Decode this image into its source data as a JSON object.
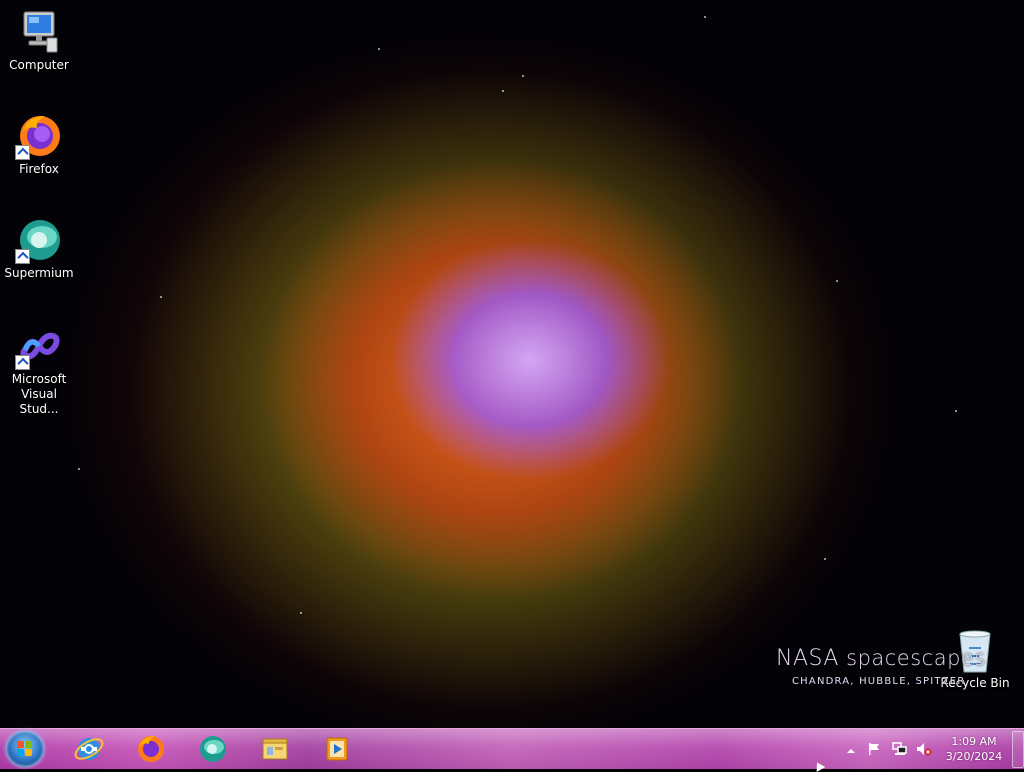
{
  "desktop": {
    "wallpaper": "Crab Nebula",
    "watermark": {
      "title_a": "NASA",
      "title_b": "spacescapes",
      "subtitle": "CHANDRA, HUBBLE, SPITZER"
    },
    "icons": [
      {
        "label": "Computer",
        "icon": "computer-icon"
      },
      {
        "label": "Firefox",
        "icon": "firefox-icon"
      },
      {
        "label": "Supermium",
        "icon": "supermium-icon"
      },
      {
        "label_line1": "Microsoft",
        "label_line2": "Visual Stud...",
        "icon": "visual-studio-icon"
      },
      {
        "label": "Recycle Bin",
        "icon": "recycle-bin-icon"
      }
    ]
  },
  "taskbar": {
    "start": {
      "icon": "windows-start-icon"
    },
    "pinned": [
      {
        "icon": "internet-explorer-icon"
      },
      {
        "icon": "firefox-icon"
      },
      {
        "icon": "supermium-icon"
      },
      {
        "icon": "file-explorer-icon"
      },
      {
        "icon": "media-player-icon"
      }
    ],
    "tray": {
      "icons": [
        "show-hidden-icons-arrow",
        "action-center-flag-icon",
        "network-icon",
        "volume-muted-icon"
      ],
      "time": "1:09 AM",
      "date": "3/20/2024"
    },
    "colors": {
      "accent": "#b03aa8"
    }
  }
}
